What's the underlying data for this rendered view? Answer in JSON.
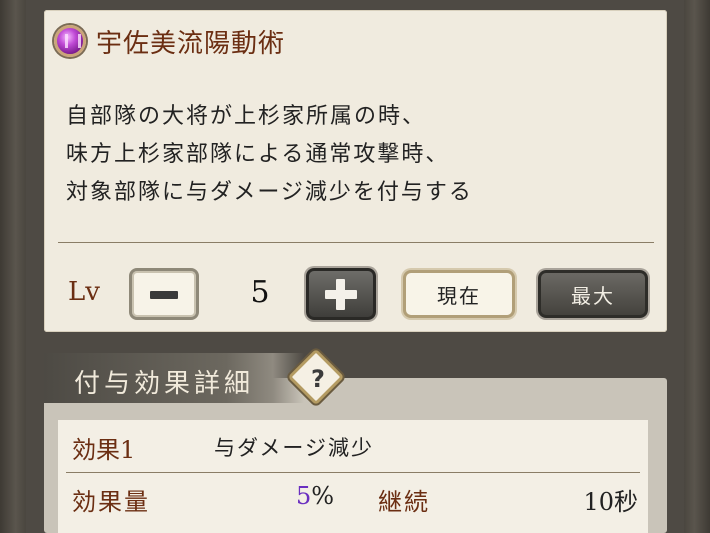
{
  "skill": {
    "icon": "purple-gem-icon",
    "title": "宇佐美流陽動術",
    "description": [
      "自部隊の大将が上杉家所属の時、",
      "味方上杉家部隊による通常攻撃時、",
      "対象部隊に与ダメージ減少を付与する"
    ]
  },
  "level": {
    "label": "Lv",
    "value": "5",
    "current_label": "現在",
    "max_label": "最大"
  },
  "detail": {
    "header": "付与効果詳細",
    "help_glyph": "?",
    "effect_name": "効果1",
    "effect_desc": "与ダメージ減少",
    "amount_label": "効果量",
    "amount_value": "5",
    "amount_unit": "%",
    "amount_color": "#6a2fc0",
    "duration_label": "継続",
    "duration_value": "10秒"
  },
  "colors": {
    "title_brown": "#6b2e12",
    "panel_bg": "#f0ebdf"
  }
}
